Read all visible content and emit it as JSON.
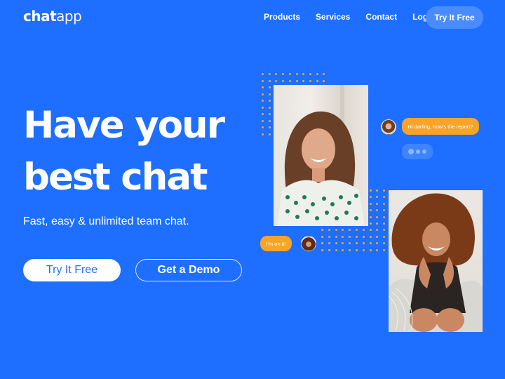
{
  "header": {
    "logo": {
      "bold": "chat",
      "light": "app"
    },
    "nav": [
      {
        "label": "Products"
      },
      {
        "label": "Services"
      },
      {
        "label": "Contact"
      },
      {
        "label": "Log In"
      }
    ],
    "cta_label": "Try It Free"
  },
  "hero": {
    "headline_line1": "Have your",
    "headline_line2": "best chat",
    "subtitle": "Fast, easy & unlimited team chat.",
    "primary_button": "Try It Free",
    "secondary_button": "Get a Demo"
  },
  "chat_preview": {
    "message_incoming": "Hi darling, how's the report?",
    "message_outgoing": "I'm on it!",
    "typing_indicator": "typing"
  },
  "colors": {
    "background": "#1e6fff",
    "accent_orange": "#f8a429",
    "nav_cta_bg": "#4a8cff"
  }
}
